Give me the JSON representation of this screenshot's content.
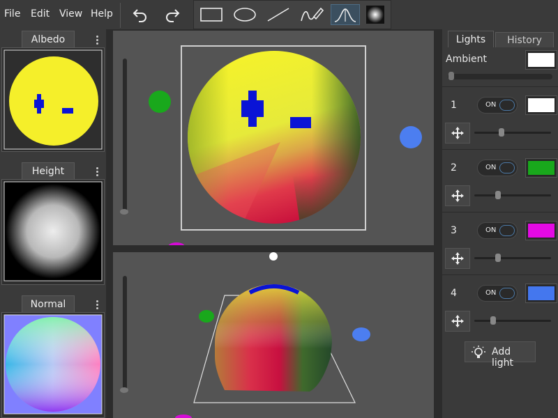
{
  "menu": {
    "file": "File",
    "edit": "Edit",
    "view": "View",
    "help": "Help"
  },
  "toolbar": {
    "undo_icon": "undo-icon",
    "redo_icon": "redo-icon",
    "tools": [
      "rectangle",
      "ellipse",
      "line",
      "brush",
      "bump-curve",
      "radial-gradient"
    ],
    "active_tool": "bump-curve"
  },
  "left": {
    "albedo": "Albedo",
    "height": "Height",
    "normal": "Normal"
  },
  "right": {
    "tabs": {
      "lights": "Lights",
      "history": "History"
    },
    "active_tab": "Lights",
    "ambient": {
      "label": "Ambient",
      "color": "#ffffff",
      "level": 0.0
    },
    "lights": [
      {
        "num": "1",
        "state": "ON",
        "color": "#ffffff",
        "level": 0.35
      },
      {
        "num": "2",
        "state": "ON",
        "color": "#19a81c",
        "level": 0.3
      },
      {
        "num": "3",
        "state": "ON",
        "color": "#e40ae4",
        "level": 0.3
      },
      {
        "num": "4",
        "state": "ON",
        "color": "#4477ee",
        "level": 0.23
      }
    ],
    "add_light": "Add light"
  },
  "scene": {
    "light_colors": {
      "green": "#19a81c",
      "blue": "#4c7ef0",
      "magenta": "#d60ad6",
      "white": "#ffffff"
    }
  }
}
